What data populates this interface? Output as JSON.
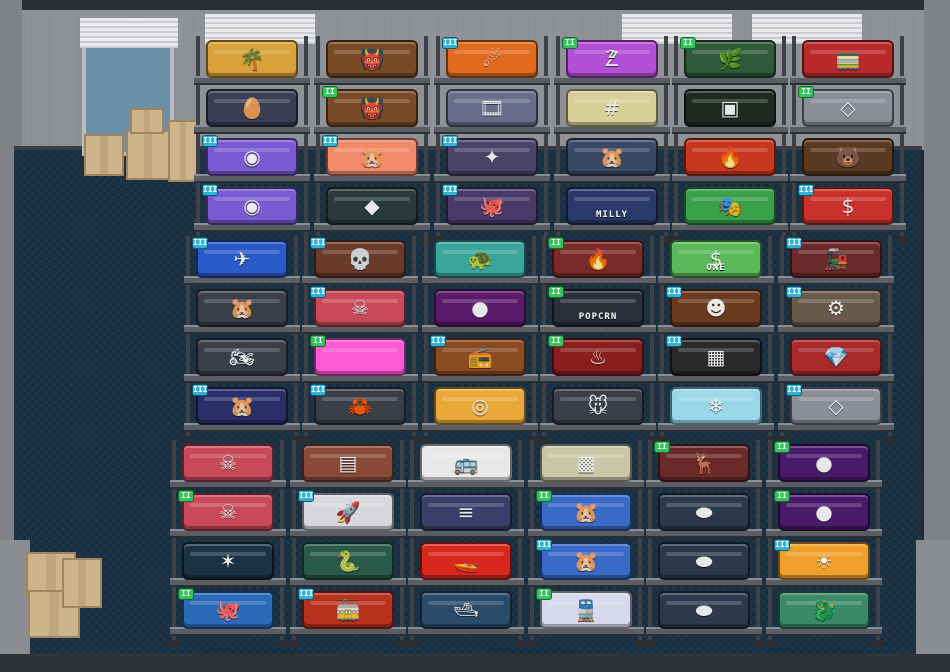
{
  "scene": {
    "palette": {
      "floor": "#1b3245",
      "wall": "#8e9196",
      "rack": "#3e4247",
      "shelf": "#5a5e64"
    }
  },
  "tier_badges": {
    "tier2": "II",
    "tier3": "III"
  },
  "racks": [
    {
      "id": "rack-1",
      "items": [
        {
          "name": "tropical-island-diorama",
          "icon": "palm-island-icon",
          "color": "#d8a13a",
          "glyph": "🌴",
          "tier": ""
        },
        {
          "name": "easter-eggs-display",
          "icon": "colored-eggs-icon",
          "color": "#3a3f55",
          "glyph": "🥚",
          "tier": ""
        },
        {
          "name": "portal-machine",
          "icon": "portal-icon",
          "color": "#7a5bd1",
          "glyph": "◉",
          "tier": "tier3"
        },
        {
          "name": "portal-machine-2",
          "icon": "portal-icon",
          "color": "#7a5bd1",
          "glyph": "◉",
          "tier": "tier3"
        }
      ]
    },
    {
      "id": "rack-2",
      "items": [
        {
          "name": "tribal-mask-fire",
          "icon": "mask-icon",
          "color": "#7a4a26",
          "glyph": "👹",
          "tier": ""
        },
        {
          "name": "tribal-mask-fire-2",
          "icon": "mask-icon",
          "color": "#7a4a26",
          "glyph": "👹",
          "tier": "tier2"
        },
        {
          "name": "hamster-cage-pink",
          "icon": "hamster-icon",
          "color": "#f08a6a",
          "glyph": "🐹",
          "tier": "tier3"
        },
        {
          "name": "green-gem-console",
          "icon": "gem-icon",
          "color": "#2a3a3a",
          "glyph": "◆",
          "tier": ""
        }
      ]
    },
    {
      "id": "rack-3",
      "items": [
        {
          "name": "orange-lava-rock",
          "icon": "lava-icon",
          "color": "#e06a1e",
          "glyph": "☄",
          "tier": "tier3"
        },
        {
          "name": "film-projector",
          "icon": "film-reel-icon",
          "color": "#6a6e8a",
          "glyph": "🎞",
          "tier": ""
        },
        {
          "name": "star-console",
          "icon": "star-icon",
          "color": "#4a4468",
          "glyph": "✦",
          "tier": "tier3"
        },
        {
          "name": "tentacle-machine",
          "icon": "tentacle-icon",
          "color": "#4a3a6a",
          "glyph": "🐙",
          "tier": "tier3"
        }
      ]
    },
    {
      "id": "rack-4",
      "items": [
        {
          "name": "sleep-pillow-purple",
          "icon": "sleep-icon",
          "color": "#b24fd6",
          "glyph": "Z",
          "tier": "tier2",
          "label_top": "Z"
        },
        {
          "name": "retro-computer",
          "icon": "computer-icon",
          "color": "#d8cf9a",
          "glyph": "#",
          "tier": ""
        },
        {
          "name": "hamster-arcade",
          "icon": "hamster-icon",
          "color": "#3a4a66",
          "glyph": "🐹",
          "tier": ""
        },
        {
          "name": "milly-display",
          "icon": "sign-icon",
          "color": "#2a3a6a",
          "glyph": "",
          "tier": "",
          "label": "MILLY"
        }
      ]
    },
    {
      "id": "rack-5",
      "items": [
        {
          "name": "jungle-vines",
          "icon": "vine-icon",
          "color": "#2f5a3a",
          "glyph": "🌿",
          "tier": "tier2"
        },
        {
          "name": "green-led-panel",
          "icon": "led-panel-icon",
          "color": "#1e2a22",
          "glyph": "▣",
          "tier": ""
        },
        {
          "name": "fire-grill-box",
          "icon": "fire-icon",
          "color": "#c8381e",
          "glyph": "🔥",
          "tier": ""
        },
        {
          "name": "carnival-mask",
          "icon": "carnival-mask-icon",
          "color": "#3aa04a",
          "glyph": "🎭",
          "tier": ""
        }
      ]
    },
    {
      "id": "rack-6",
      "items": [
        {
          "name": "red-train-car",
          "icon": "train-icon",
          "color": "#b82a2a",
          "glyph": "🚃",
          "tier": ""
        },
        {
          "name": "metal-pipe-gem",
          "icon": "pipe-icon",
          "color": "#8a8e96",
          "glyph": "◇",
          "tier": "tier2"
        },
        {
          "name": "bear-statue",
          "icon": "bear-icon",
          "color": "#5a3a22",
          "glyph": "🐻",
          "tier": ""
        },
        {
          "name": "red-cash-machine",
          "icon": "cash-icon",
          "color": "#c8322a",
          "glyph": "$",
          "tier": "tier3"
        }
      ]
    },
    {
      "id": "rack-7",
      "items": [
        {
          "name": "blue-jet-plane",
          "icon": "plane-icon",
          "color": "#2a5ac8",
          "glyph": "✈",
          "tier": "tier3"
        },
        {
          "name": "hamster-gym",
          "icon": "hamster-icon",
          "color": "#3a3f4a",
          "glyph": "🐹",
          "tier": ""
        },
        {
          "name": "hamster-motorbike",
          "icon": "hamster-icon",
          "color": "#3a3f4a",
          "glyph": "🏍",
          "tier": ""
        },
        {
          "name": "hamster-racer",
          "icon": "hamster-icon",
          "color": "#2a2f6a",
          "glyph": "🐹",
          "tier": "tier3"
        }
      ]
    },
    {
      "id": "rack-8",
      "items": [
        {
          "name": "skull-totem",
          "icon": "skull-icon",
          "color": "#6a3a2a",
          "glyph": "💀",
          "tier": "tier3"
        },
        {
          "name": "red-bone-pit",
          "icon": "bone-icon",
          "color": "#c84a5a",
          "glyph": "☠",
          "tier": "tier3"
        },
        {
          "name": "pink-gel-pad",
          "icon": "gel-icon",
          "color": "#ff5ad6",
          "glyph": "",
          "tier": "tier2"
        },
        {
          "name": "crab-robot",
          "icon": "crab-icon",
          "color": "#3a3f4a",
          "glyph": "🦀",
          "tier": "tier3"
        }
      ]
    },
    {
      "id": "rack-9",
      "items": [
        {
          "name": "sea-turtle",
          "icon": "turtle-icon",
          "color": "#3aa59a",
          "glyph": "🐢",
          "tier": ""
        },
        {
          "name": "black-hole-portal",
          "icon": "black-hole-icon",
          "color": "#5a1a6a",
          "glyph": "●",
          "tier": ""
        },
        {
          "name": "wooden-radio",
          "icon": "radio-icon",
          "color": "#8a4a22",
          "glyph": "📻",
          "tier": "tier3"
        },
        {
          "name": "blue-dial-console",
          "icon": "dial-icon",
          "color": "#e8a83a",
          "glyph": "◎",
          "tier": ""
        }
      ]
    },
    {
      "id": "rack-10",
      "items": [
        {
          "name": "campfire-pit",
          "icon": "campfire-icon",
          "color": "#7a2a2a",
          "glyph": "🔥",
          "tier": "tier2"
        },
        {
          "name": "popcorn-machine",
          "icon": "popcorn-icon",
          "color": "#2a2f3a",
          "glyph": "",
          "tier": "tier2",
          "label": "POPCRN"
        },
        {
          "name": "lava-coil-box",
          "icon": "lava-icon",
          "color": "#8a1e1e",
          "glyph": "♨",
          "tier": "tier2"
        },
        {
          "name": "mouse-in-fire",
          "icon": "mouse-icon",
          "color": "#3a3f4a",
          "glyph": "🐭",
          "tier": ""
        }
      ]
    },
    {
      "id": "rack-11",
      "items": [
        {
          "name": "green-dollar-bill",
          "icon": "dollar-icon",
          "color": "#5ab85a",
          "glyph": "$",
          "tier": "",
          "label": "ONE"
        },
        {
          "name": "tiki-face",
          "icon": "tiki-icon",
          "color": "#6a3a1e",
          "glyph": "☻",
          "tier": "tier3"
        },
        {
          "name": "boombox",
          "icon": "boombox-icon",
          "color": "#2a2a2a",
          "glyph": "▦",
          "tier": "tier3"
        },
        {
          "name": "ice-crystal",
          "icon": "crystal-icon",
          "color": "#9ad8e8",
          "glyph": "❄",
          "tier": ""
        }
      ]
    },
    {
      "id": "rack-12",
      "items": [
        {
          "name": "steam-locomotive",
          "icon": "locomotive-icon",
          "color": "#6a2a2a",
          "glyph": "🚂",
          "tier": "tier3"
        },
        {
          "name": "piston-engine",
          "icon": "engine-icon",
          "color": "#6a5a4a",
          "glyph": "⚙",
          "tier": "tier3"
        },
        {
          "name": "treasure-hoard",
          "icon": "treasure-icon",
          "color": "#a82a2a",
          "glyph": "💎",
          "tier": ""
        },
        {
          "name": "metal-pipe-gem-2",
          "icon": "pipe-icon",
          "color": "#8a8e96",
          "glyph": "◇",
          "tier": "tier3"
        }
      ]
    },
    {
      "id": "rack-13",
      "items": [
        {
          "name": "red-bone-pit-2",
          "icon": "bone-icon",
          "color": "#c84a5a",
          "glyph": "☠",
          "tier": ""
        },
        {
          "name": "red-bone-pit-3",
          "icon": "bone-icon",
          "color": "#c84a5a",
          "glyph": "☠",
          "tier": "tier2"
        },
        {
          "name": "shadow-creature",
          "icon": "creature-icon",
          "color": "#1b3245",
          "glyph": "✶",
          "tier": ""
        },
        {
          "name": "octopus-aquarium",
          "icon": "octopus-icon",
          "color": "#2a6ab8",
          "glyph": "🐙",
          "tier": "tier2"
        }
      ]
    },
    {
      "id": "rack-14",
      "items": [
        {
          "name": "brick-wall",
          "icon": "brick-icon",
          "color": "#8a4a3a",
          "glyph": "▤",
          "tier": ""
        },
        {
          "name": "white-rocket-train",
          "icon": "rocket-icon",
          "color": "#d8d8dc",
          "glyph": "🚀",
          "tier": "tier3"
        },
        {
          "name": "green-serpents",
          "icon": "serpent-icon",
          "color": "#2a5a4a",
          "glyph": "🐍",
          "tier": ""
        },
        {
          "name": "red-trolley-car",
          "icon": "trolley-icon",
          "color": "#b8321e",
          "glyph": "🚋",
          "tier": "tier3"
        }
      ]
    },
    {
      "id": "rack-15",
      "items": [
        {
          "name": "city-bus",
          "icon": "bus-icon",
          "color": "#e8e8ea",
          "glyph": "🚌",
          "tier": ""
        },
        {
          "name": "solana-capsule",
          "icon": "solana-icon",
          "color": "#3a3f6a",
          "glyph": "≡",
          "tier": ""
        },
        {
          "name": "red-speedboat",
          "icon": "speedboat-icon",
          "color": "#d8281e",
          "glyph": "🚤",
          "tier": ""
        },
        {
          "name": "white-yacht",
          "icon": "yacht-icon",
          "color": "#2a4a6a",
          "glyph": "🛥",
          "tier": ""
        }
      ]
    },
    {
      "id": "rack-16",
      "items": [
        {
          "name": "cheese-block",
          "icon": "cheese-icon",
          "color": "#c8c8a8",
          "glyph": "▩",
          "tier": ""
        },
        {
          "name": "hamster-bathtub",
          "icon": "hamster-icon",
          "color": "#3a6ac8",
          "glyph": "🐹",
          "tier": "tier2"
        },
        {
          "name": "hamster-bathtub-2",
          "icon": "hamster-icon",
          "color": "#3a6ac8",
          "glyph": "🐹",
          "tier": "tier3"
        },
        {
          "name": "blue-subway-train",
          "icon": "subway-icon",
          "color": "#d8d8ec",
          "glyph": "🚆",
          "tier": "tier2"
        }
      ]
    },
    {
      "id": "rack-17",
      "items": [
        {
          "name": "reindeer-herd",
          "icon": "reindeer-icon",
          "color": "#6a2a2a",
          "glyph": "🦌",
          "tier": "tier2"
        },
        {
          "name": "dark-pods",
          "icon": "pod-icon",
          "color": "#2a3a4a",
          "glyph": "⬬",
          "tier": ""
        },
        {
          "name": "dark-pods-2",
          "icon": "pod-icon",
          "color": "#2a3a4a",
          "glyph": "⬬",
          "tier": ""
        },
        {
          "name": "dark-pods-3",
          "icon": "pod-icon",
          "color": "#2a3a4a",
          "glyph": "⬬",
          "tier": ""
        }
      ]
    },
    {
      "id": "rack-18",
      "items": [
        {
          "name": "black-hole-portal-2",
          "icon": "black-hole-icon",
          "color": "#4a1a6a",
          "glyph": "●",
          "tier": "tier2"
        },
        {
          "name": "black-hole-portal-3",
          "icon": "black-hole-icon",
          "color": "#4a1a6a",
          "glyph": "●",
          "tier": "tier2"
        },
        {
          "name": "golden-sun-box",
          "icon": "sun-icon",
          "color": "#f0a02a",
          "glyph": "☀",
          "tier": "tier3"
        },
        {
          "name": "jade-dragon-tiles",
          "icon": "dragon-icon",
          "color": "#3a8a6a",
          "glyph": "🐉",
          "tier": ""
        }
      ]
    }
  ]
}
